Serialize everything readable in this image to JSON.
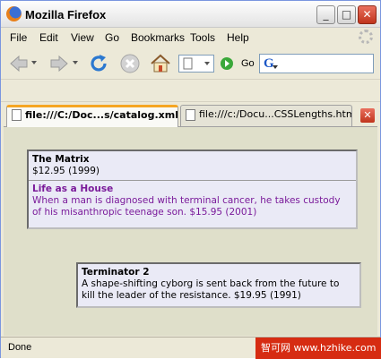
{
  "window": {
    "title": "Mozilla Firefox",
    "controls": {
      "minimize": "_",
      "maximize": "□",
      "close": "✕"
    }
  },
  "menu": {
    "items": [
      "File",
      "Edit",
      "View",
      "Go",
      "Bookmarks",
      "Tools",
      "Help"
    ]
  },
  "toolbar": {
    "icons": [
      "back-icon",
      "forward-icon",
      "reload-icon",
      "stop-icon",
      "home-icon"
    ],
    "go_label": "Go",
    "search_logo": "G"
  },
  "tabs": [
    {
      "label": "file:///C:/Doc...s/catalog.xml",
      "active": true
    },
    {
      "label": "file:///c:/Docu...CSSLengths.html",
      "active": false
    }
  ],
  "content": {
    "block1": [
      {
        "title": "The Matrix",
        "line": "$12.95 (1999)"
      },
      {
        "title": "Life as a House",
        "line": "When a man is diagnosed with terminal cancer, he takes custody of his misanthropic teenage son. $15.95 (2001)"
      }
    ],
    "block2": [
      {
        "title": "Terminator 2",
        "line": "A shape-shifting cyborg is sent back from the future to kill the leader of the resistance. $19.95 (1991)"
      }
    ]
  },
  "status": {
    "text": "Done",
    "watermark": "智可网 www.hzhike.com"
  },
  "colors": {
    "accent_tab": "#f5a623",
    "content_bg": "#dfdfca",
    "block_bg": "#eaeaf6",
    "highlight_text": "#7a1a9a"
  }
}
